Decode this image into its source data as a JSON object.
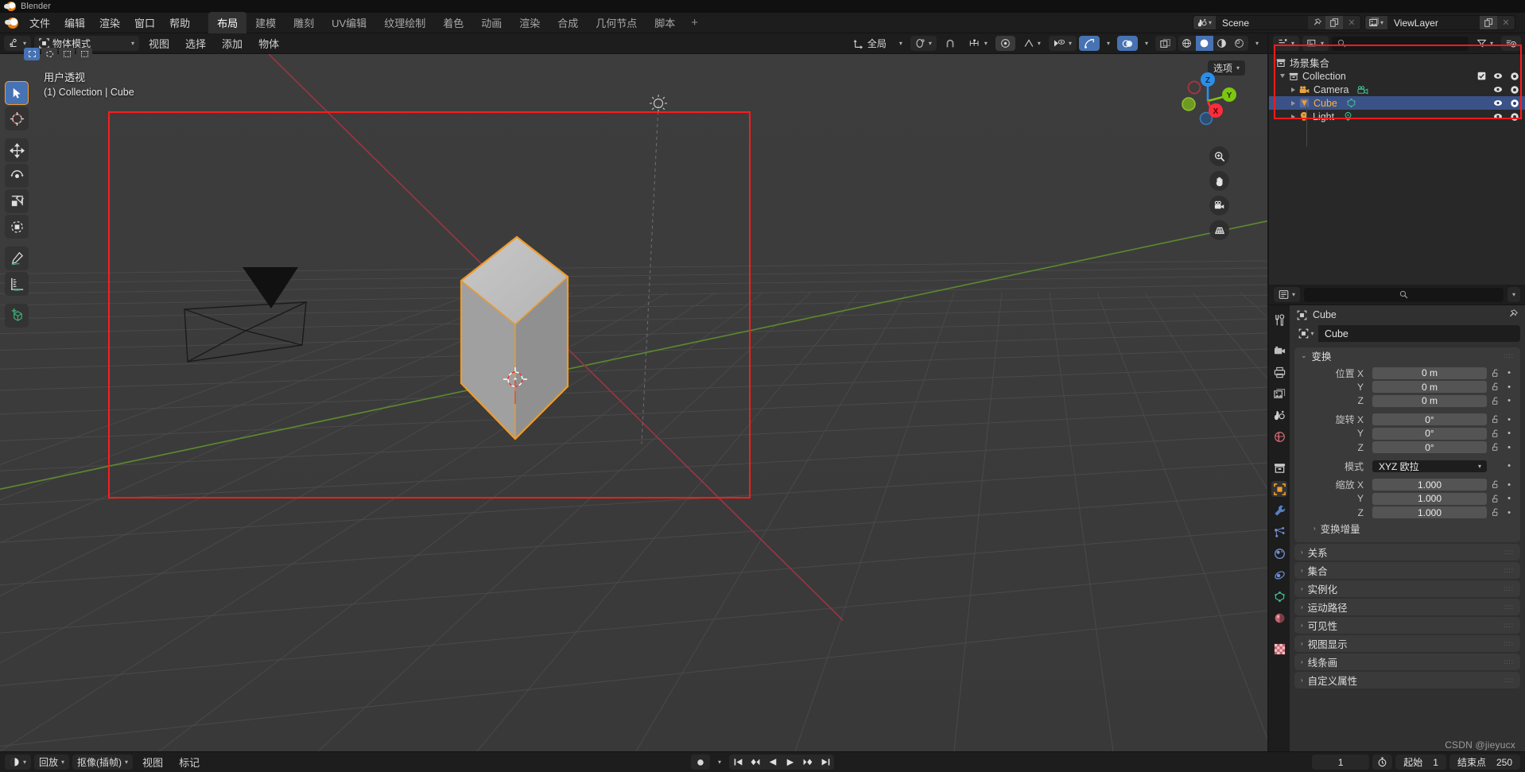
{
  "window": {
    "title": "Blender"
  },
  "topbar": {
    "menus": [
      "文件",
      "编辑",
      "渲染",
      "窗口",
      "帮助"
    ],
    "workspaces": [
      {
        "label": "布局",
        "active": true
      },
      {
        "label": "建模",
        "active": false
      },
      {
        "label": "雕刻",
        "active": false
      },
      {
        "label": "UV编辑",
        "active": false
      },
      {
        "label": "纹理绘制",
        "active": false
      },
      {
        "label": "着色",
        "active": false
      },
      {
        "label": "动画",
        "active": false
      },
      {
        "label": "渲染",
        "active": false
      },
      {
        "label": "合成",
        "active": false
      },
      {
        "label": "几何节点",
        "active": false
      },
      {
        "label": "脚本",
        "active": false
      }
    ],
    "add_workspace": "+",
    "scene": {
      "icon": "scene-icon",
      "name": "Scene"
    },
    "viewlayer": {
      "icon": "viewlayer-icon",
      "name": "ViewLayer"
    }
  },
  "viewport_header": {
    "editor_type_icon": "editor-type-icon",
    "mode": "物体模式",
    "menus": [
      "视图",
      "选择",
      "添加",
      "物体"
    ],
    "transform_orientation": "全局",
    "snap_icon": "snap-magnet-icon",
    "proportional_icon": "proportional-edit-icon",
    "options_label": "选项"
  },
  "viewport": {
    "overlay_line1": "用户透视",
    "overlay_line2": "(1) Collection | Cube",
    "gizmo_axes": [
      {
        "label": "X",
        "color": "#fc2c3a"
      },
      {
        "label": "Y",
        "color": "#7dc710"
      },
      {
        "label": "Z",
        "color": "#2a8fea"
      }
    ],
    "nav_buttons": [
      "zoom-icon",
      "hand-icon",
      "camera-icon",
      "grid-ortho-icon"
    ],
    "tools": [
      {
        "name": "tweak-select-tool",
        "active": true
      },
      {
        "name": "cursor-tool",
        "active": false
      },
      {
        "name": "move-tool",
        "active": false
      },
      {
        "name": "rotate-tool",
        "active": false
      },
      {
        "name": "scale-tool",
        "active": false
      },
      {
        "name": "transform-tool",
        "active": false
      },
      {
        "name": "annotate-tool",
        "active": false
      },
      {
        "name": "measure-tool",
        "active": false
      },
      {
        "name": "add-cube-tool",
        "active": false
      }
    ],
    "select_modes": [
      "box-select",
      "circle-select",
      "lasso-select",
      "extend-select"
    ],
    "highlight_color": "#ff1b1b"
  },
  "outliner": {
    "display_mode_icon": "outliner-display-icon",
    "filter_icon": "filter-icon",
    "new_collection_icon": "new-collection-icon",
    "search_placeholder": "",
    "root": "场景集合",
    "items": [
      {
        "name": "Collection",
        "type": "collection",
        "depth": 0,
        "expanded": true,
        "selected": false,
        "checkbox": true,
        "eye": true,
        "camera": true
      },
      {
        "name": "Camera",
        "type": "camera",
        "depth": 1,
        "expanded": false,
        "selected": false,
        "checkbox": false,
        "eye": true,
        "camera": true
      },
      {
        "name": "Cube",
        "type": "mesh",
        "depth": 1,
        "expanded": false,
        "selected": true,
        "checkbox": false,
        "eye": true,
        "camera": true
      },
      {
        "name": "Light",
        "type": "light",
        "depth": 1,
        "expanded": false,
        "selected": false,
        "checkbox": false,
        "eye": true,
        "camera": true
      }
    ],
    "highlight_color": "#ff1b1b"
  },
  "properties": {
    "search_placeholder": "",
    "breadcrumb_object": "Cube",
    "object_name": "Cube",
    "tabs": [
      {
        "name": "tool-tab",
        "active": false
      },
      {
        "name": "render-tab",
        "active": false
      },
      {
        "name": "output-tab",
        "active": false
      },
      {
        "name": "view-layer-tab",
        "active": false
      },
      {
        "name": "scene-tab",
        "active": false
      },
      {
        "name": "world-tab",
        "active": false
      },
      {
        "name": "collection-tab",
        "active": false
      },
      {
        "name": "object-tab",
        "active": true
      },
      {
        "name": "modifier-tab",
        "active": false
      },
      {
        "name": "particles-tab",
        "active": false
      },
      {
        "name": "physics-tab",
        "active": false
      },
      {
        "name": "constraints-tab",
        "active": false
      },
      {
        "name": "object-data-tab",
        "active": false
      },
      {
        "name": "material-tab",
        "active": false
      },
      {
        "name": "texture-tab",
        "active": false
      }
    ],
    "transform_panel": {
      "title": "变换",
      "groups": [
        {
          "label": "位置",
          "unit": "m",
          "rows": [
            {
              "axis": "X",
              "value": "0 m"
            },
            {
              "axis": "Y",
              "value": "0 m"
            },
            {
              "axis": "Z",
              "value": "0 m"
            }
          ]
        },
        {
          "label": "旋转",
          "unit": "°",
          "rows": [
            {
              "axis": "X",
              "value": "0°"
            },
            {
              "axis": "Y",
              "value": "0°"
            },
            {
              "axis": "Z",
              "value": "0°"
            }
          ]
        }
      ],
      "mode_label": "模式",
      "mode_value": "XYZ 欧拉",
      "scale": {
        "label": "缩放",
        "rows": [
          {
            "axis": "X",
            "value": "1.000"
          },
          {
            "axis": "Y",
            "value": "1.000"
          },
          {
            "axis": "Z",
            "value": "1.000"
          }
        ]
      },
      "delta_transform": "变换增量"
    },
    "collapsed_panels": [
      "关系",
      "集合",
      "实例化",
      "运动路径",
      "可见性",
      "视图显示",
      "线条画",
      "自定义属性"
    ]
  },
  "timeline": {
    "editor_icon": "timeline-editor-icon",
    "menus": [
      "回放",
      "抠像(插帧)",
      "视图",
      "标记"
    ],
    "record_icon": "record-icon",
    "transport": [
      "jump-to-start",
      "prev-keyframe",
      "play-reverse",
      "play",
      "next-keyframe",
      "jump-to-end"
    ],
    "current_frame": "1",
    "autokey_icon": "stopwatch-icon",
    "start_label": "起始",
    "start_value": "1",
    "end_label": "结束点",
    "end_value": "250"
  },
  "watermark": "CSDN @jieyucx"
}
